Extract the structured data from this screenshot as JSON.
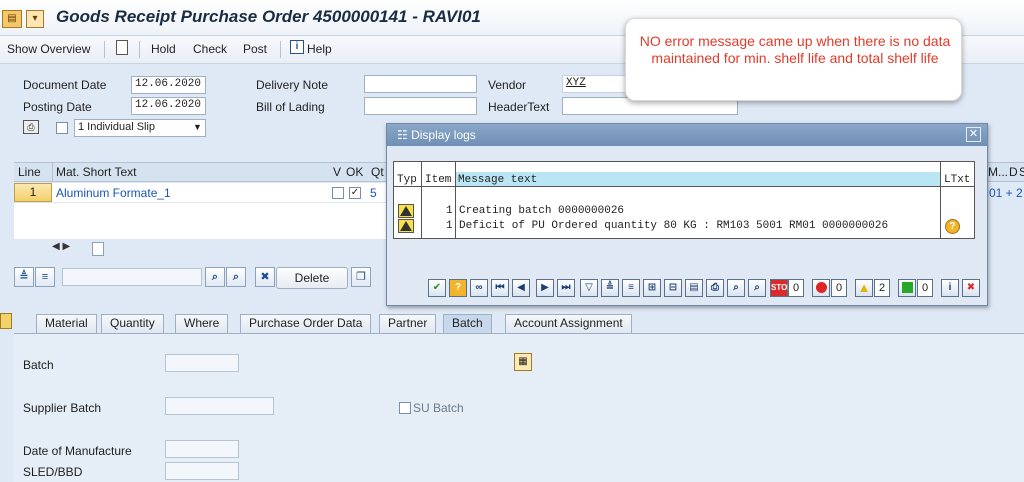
{
  "window": {
    "title": "Goods Receipt Purchase Order 4500000141 - RAVI01"
  },
  "toolbar": {
    "show_overview": "Show Overview",
    "hold": "Hold",
    "check": "Check",
    "post": "Post",
    "help": "Help"
  },
  "header": {
    "document_date_label": "Document Date",
    "document_date": "12.06.2020",
    "posting_date_label": "Posting Date",
    "posting_date": "12.06.2020",
    "delivery_note_label": "Delivery Note",
    "delivery_note": "",
    "bill_of_lading_label": "Bill of Lading",
    "bill_of_lading": "",
    "vendor_label": "Vendor",
    "vendor": "XYZ",
    "header_text_label": "HeaderText",
    "header_text": "",
    "slip_option": "1 Individual Slip"
  },
  "callout": {
    "text": "NO error message came up when there is no data maintained for min. shelf life and total shelf life"
  },
  "items_grid": {
    "columns": [
      "Line",
      "Mat. Short Text",
      "V",
      "OK",
      "Qt",
      "M...",
      "D",
      "S"
    ],
    "rows": [
      {
        "line": "1",
        "material": "Aluminum Formate_1",
        "ok_checked": true,
        "qty": "5",
        "extra": "01 + 2"
      }
    ]
  },
  "grid_buttons": {
    "delete": "Delete"
  },
  "tabs": [
    "Material",
    "Quantity",
    "Where",
    "Purchase Order Data",
    "Partner",
    "Batch",
    "Account Assignment"
  ],
  "active_tab": "Batch",
  "batch_tab": {
    "batch_label": "Batch",
    "batch": "",
    "supplier_batch_label": "Supplier Batch",
    "supplier_batch": "",
    "su_batch_label": "SU Batch",
    "date_of_manufacture_label": "Date of Manufacture",
    "sled_bbd_label": "SLED/BBD"
  },
  "dialog": {
    "title": "Display logs",
    "columns": {
      "typ": "Typ",
      "item": "Item",
      "message": "Message text",
      "ltxt": "LTxt"
    },
    "messages": [
      {
        "type": "warning",
        "item": "1",
        "text": "Creating batch 0000000026",
        "has_longtext": false
      },
      {
        "type": "warning",
        "item": "1",
        "text": "Deficit of PU Ordered quantity 80 KG : RM103 5001 RM01 0000000026",
        "has_longtext": true
      }
    ],
    "counts": {
      "stop": "0",
      "error": "0",
      "warning": "2",
      "success": "0"
    }
  }
}
